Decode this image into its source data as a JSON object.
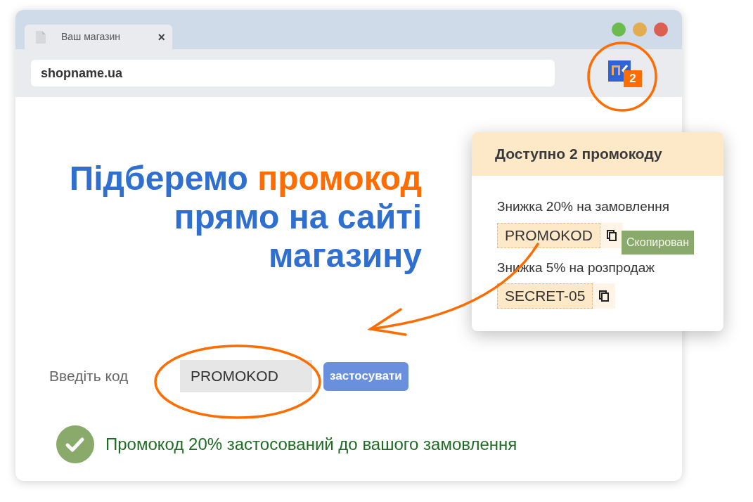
{
  "browser": {
    "tab": {
      "title": "Ваш магазин",
      "close": "×"
    },
    "address": "shopname.ua",
    "extension_badge": "2"
  },
  "headline": [
    [
      {
        "text": "Підберемо ",
        "accent": false
      },
      {
        "text": "промокод",
        "accent": true
      }
    ],
    [
      {
        "text": "прямо на сайті",
        "accent": false
      }
    ],
    [
      {
        "text": "магазину",
        "accent": false
      }
    ]
  ],
  "promo_form": {
    "label": "Введіть код",
    "value": "PROMOKOD",
    "button": "застосувати"
  },
  "success_message": "Промокод 20% застосований до вашого замовлення",
  "popup": {
    "title": "Доступно 2 промокоду",
    "codes": [
      {
        "description": "Знижка 20% на замовлення",
        "code": "PROMOKOD",
        "copied": true,
        "tooltip": "Скопирован"
      },
      {
        "description": "Знижка 5% на розпродаж",
        "code": "SECRET-05",
        "copied": false
      }
    ]
  }
}
